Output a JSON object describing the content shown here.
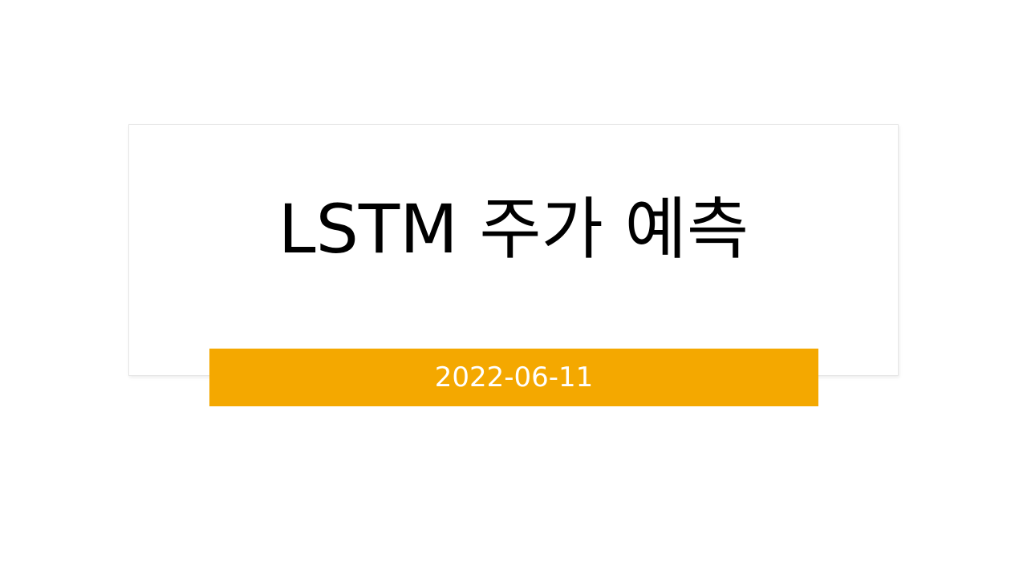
{
  "slide": {
    "title": "LSTM 주가 예측",
    "subtitle": "2022-06-11"
  },
  "colors": {
    "background": "#ffffff",
    "accent_bar": "#f4a800",
    "title_text": "#000000",
    "subtitle_text": "#ffffff",
    "box_border": "#e6e6e6"
  }
}
